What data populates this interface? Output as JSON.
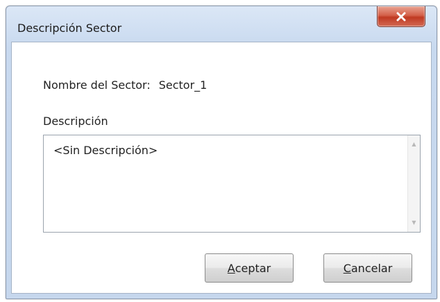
{
  "window": {
    "title": "Descripción Sector",
    "close_icon": "close-icon"
  },
  "sector": {
    "label": "Nombre del Sector:",
    "value": "Sector_1"
  },
  "description": {
    "label": "Descripción",
    "value": "<Sin Descripción>"
  },
  "buttons": {
    "accept": {
      "mnemonic": "A",
      "rest": "ceptar"
    },
    "cancel": {
      "mnemonic": "C",
      "rest": "ancelar"
    }
  },
  "colors": {
    "close_button": "#c8452e",
    "title_bar": "#cfdff3"
  }
}
